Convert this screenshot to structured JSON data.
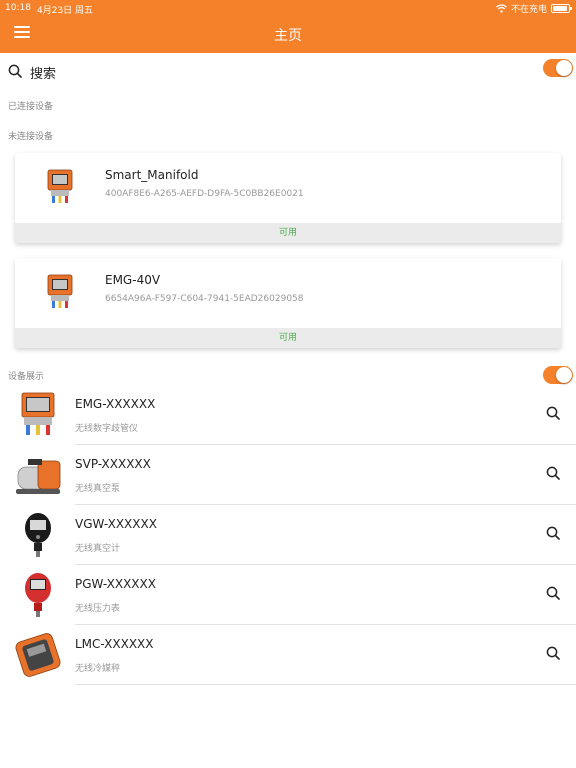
{
  "status_bar": {
    "time": "10:18",
    "date": "4月23日 周五",
    "charging": "不在充电",
    "battery_level": 0.9
  },
  "header": {
    "title": "主页",
    "menu_icon": "hamburger-icon",
    "background_color": "#F5822A"
  },
  "search": {
    "label": "搜索",
    "icon": "search-icon",
    "toggle_on": true
  },
  "sections": {
    "connected": "已连接设备",
    "unconnected": "未连接设备",
    "showcase": "设备展示",
    "showcase_toggle_on": true
  },
  "unconnected_devices": [
    {
      "name": "Smart_Manifold",
      "uuid": "400AF8E6-A265-AEFD-D9FA-5C0BB26E0021",
      "status": "可用"
    },
    {
      "name": "EMG-40V",
      "uuid": "6654A96A-F597-C604-7941-5EAD26029058",
      "status": "可用"
    }
  ],
  "showcase_devices": [
    {
      "name": "EMG-XXXXXX",
      "desc": "无线数字歧管仪"
    },
    {
      "name": "SVP-XXXXXX",
      "desc": "无线真空泵"
    },
    {
      "name": "VGW-XXXXXX",
      "desc": "无线真空计"
    },
    {
      "name": "PGW-XXXXXX",
      "desc": "无线压力表"
    },
    {
      "name": "LMC-XXXXXX",
      "desc": "无线冷媒秤"
    }
  ],
  "colors": {
    "accent": "#F5822A",
    "available": "#4CAF50"
  }
}
